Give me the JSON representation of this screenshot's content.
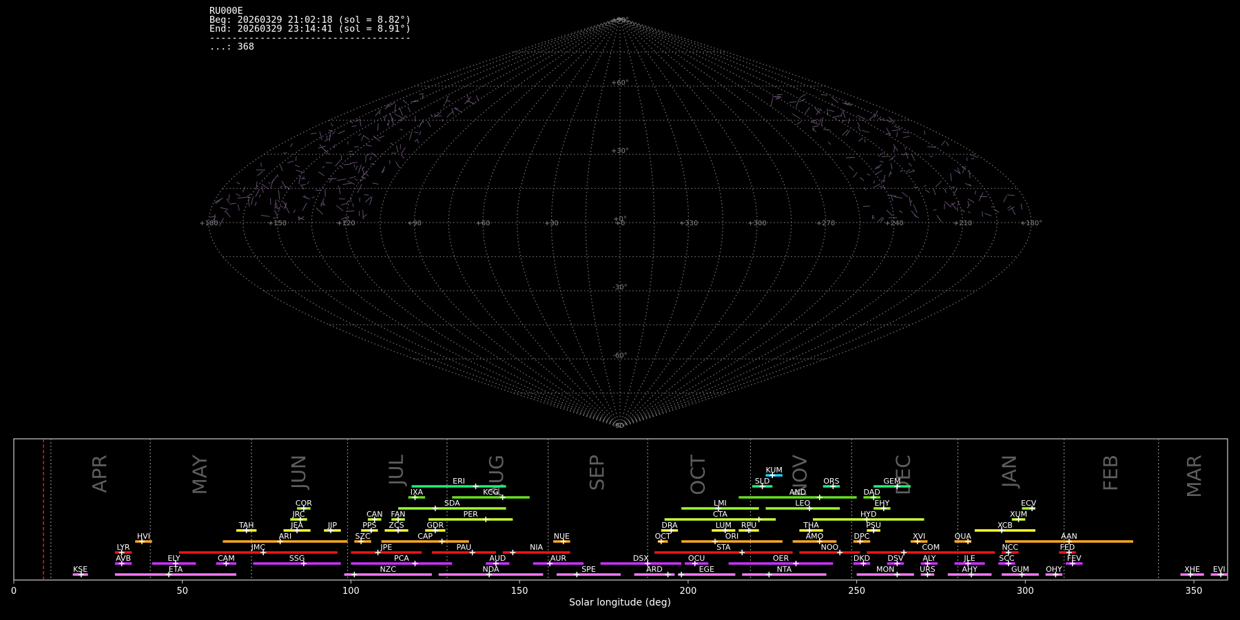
{
  "header": {
    "station": "RU000E",
    "begin": "Beg: 20260329 21:02:18 (sol = 8.82°)",
    "end": "End: 20260329 23:14:41 (sol = 8.91°)",
    "separator": "------------------------------------",
    "count": "...: 368"
  },
  "sky_map": {
    "projection": "sinusoidal",
    "lat_labels": [
      "+90°",
      "+60°",
      "+30°",
      "+0°",
      "-30°",
      "-60°",
      "-90°"
    ],
    "lat_values": [
      90,
      60,
      30,
      0,
      -30,
      -60,
      -90
    ],
    "lon_labels": [
      "+180",
      "+150",
      "+120",
      "+90",
      "+60",
      "+30",
      "+0",
      "+330",
      "+300",
      "+270",
      "+240",
      "+210",
      "+180°"
    ],
    "grid_color": "#888888",
    "meteor_color": "#8a6a9a"
  },
  "chart_data": {
    "type": "timeline",
    "xlabel": "Solar longitude (deg)",
    "xlim": [
      0,
      360
    ],
    "xticks": [
      0,
      50,
      100,
      150,
      200,
      250,
      300,
      350
    ],
    "current_sol": 8.82,
    "months": [
      {
        "label": "APR",
        "start": 11
      },
      {
        "label": "MAY",
        "start": 40.5
      },
      {
        "label": "JUN",
        "start": 70.5
      },
      {
        "label": "JUL",
        "start": 99
      },
      {
        "label": "AUG",
        "start": 128.5
      },
      {
        "label": "SEP",
        "start": 158.5
      },
      {
        "label": "OCT",
        "start": 188
      },
      {
        "label": "NOV",
        "start": 218.5
      },
      {
        "label": "DEC",
        "start": 248.5
      },
      {
        "label": "JAN",
        "start": 280
      },
      {
        "label": "FEB",
        "start": 311.5
      },
      {
        "label": "MAR",
        "start": 339.5
      }
    ],
    "rows_color": [
      "#ff77ff",
      "#cc33ff",
      "#ff1111",
      "#ffaa22",
      "#ffff33",
      "#ccff33",
      "#99ff33",
      "#66dd22",
      "#22ee77",
      "#22ccff",
      "#1111ff"
    ],
    "showers": [
      {
        "code": "KSE",
        "row": 0,
        "start": 17.5,
        "end": 22,
        "peak": 20
      },
      {
        "code": "ETA",
        "row": 0,
        "start": 30,
        "end": 66,
        "peak": 46
      },
      {
        "code": "NZC",
        "row": 0,
        "start": 98,
        "end": 124,
        "peak": 101
      },
      {
        "code": "NDA",
        "row": 0,
        "start": 126,
        "end": 157,
        "peak": 141
      },
      {
        "code": "SPE",
        "row": 0,
        "start": 161,
        "end": 180,
        "peak": 167
      },
      {
        "code": "ARD",
        "row": 0,
        "start": 184,
        "end": 196,
        "peak": 194
      },
      {
        "code": "EGE",
        "row": 0,
        "start": 197,
        "end": 214,
        "peak": 198
      },
      {
        "code": "NTA",
        "row": 0,
        "start": 216,
        "end": 241,
        "peak": 224
      },
      {
        "code": "MON",
        "row": 0,
        "start": 250,
        "end": 267,
        "peak": 262
      },
      {
        "code": "URS",
        "row": 0,
        "start": 269,
        "end": 273,
        "peak": 271
      },
      {
        "code": "AHY",
        "row": 0,
        "start": 277,
        "end": 290,
        "peak": 284
      },
      {
        "code": "GUM",
        "row": 0,
        "start": 293,
        "end": 304,
        "peak": 299
      },
      {
        "code": "OHY",
        "row": 0,
        "start": 306,
        "end": 311,
        "peak": 309
      },
      {
        "code": "XHE",
        "row": 0,
        "start": 346,
        "end": 353,
        "peak": 349
      },
      {
        "code": "EVI",
        "row": 0,
        "start": 355,
        "end": 360,
        "peak": 358
      },
      {
        "code": "AVB",
        "row": 1,
        "start": 30,
        "end": 35,
        "peak": 32
      },
      {
        "code": "ELY",
        "row": 1,
        "start": 41,
        "end": 54,
        "peak": 48
      },
      {
        "code": "CAM",
        "row": 1,
        "start": 60,
        "end": 66,
        "peak": 63
      },
      {
        "code": "SSG",
        "row": 1,
        "start": 71,
        "end": 97,
        "peak": 86
      },
      {
        "code": "PCA",
        "row": 1,
        "start": 100,
        "end": 130,
        "peak": 119
      },
      {
        "code": "AUD",
        "row": 1,
        "start": 140,
        "end": 147,
        "peak": 143
      },
      {
        "code": "AUR",
        "row": 1,
        "start": 154,
        "end": 169,
        "peak": 159
      },
      {
        "code": "DSX",
        "row": 1,
        "start": 174,
        "end": 198,
        "peak": 188
      },
      {
        "code": "OCU",
        "row": 1,
        "start": 199,
        "end": 206,
        "peak": 202
      },
      {
        "code": "OER",
        "row": 1,
        "start": 212,
        "end": 243,
        "peak": 232
      },
      {
        "code": "DKD",
        "row": 1,
        "start": 249,
        "end": 254,
        "peak": 252
      },
      {
        "code": "DSV",
        "row": 1,
        "start": 259,
        "end": 264,
        "peak": 262
      },
      {
        "code": "ALY",
        "row": 1,
        "start": 269,
        "end": 274,
        "peak": 271
      },
      {
        "code": "JLE",
        "row": 1,
        "start": 279,
        "end": 288,
        "peak": 283
      },
      {
        "code": "SCC",
        "row": 1,
        "start": 292,
        "end": 297,
        "peak": 295
      },
      {
        "code": "FEV",
        "row": 1,
        "start": 312,
        "end": 317,
        "peak": 314
      },
      {
        "code": "LYR",
        "row": 2,
        "start": 30,
        "end": 35,
        "peak": 32
      },
      {
        "code": "JMC",
        "row": 2,
        "start": 49,
        "end": 96,
        "peak": 74
      },
      {
        "code": "JPE",
        "row": 2,
        "start": 100,
        "end": 121,
        "peak": 108
      },
      {
        "code": "PAU",
        "row": 2,
        "start": 124,
        "end": 143,
        "peak": 136
      },
      {
        "code": "NIA",
        "row": 2,
        "start": 145,
        "end": 165,
        "peak": 148
      },
      {
        "code": "STA",
        "row": 2,
        "start": 190,
        "end": 231,
        "peak": 216
      },
      {
        "code": "NOO",
        "row": 2,
        "start": 233,
        "end": 251,
        "peak": 245
      },
      {
        "code": "COM",
        "row": 2,
        "start": 253,
        "end": 291,
        "peak": 264
      },
      {
        "code": "NCC",
        "row": 2,
        "start": 293,
        "end": 298,
        "peak": 295
      },
      {
        "code": "FED",
        "row": 2,
        "start": 310,
        "end": 315,
        "peak": 313
      },
      {
        "code": "HVI",
        "row": 3,
        "start": 36,
        "end": 41,
        "peak": 38
      },
      {
        "code": "ARI",
        "row": 3,
        "start": 62,
        "end": 99,
        "peak": 79
      },
      {
        "code": "SZC",
        "row": 3,
        "start": 101,
        "end": 106,
        "peak": 103
      },
      {
        "code": "CAP",
        "row": 3,
        "start": 109,
        "end": 135,
        "peak": 127
      },
      {
        "code": "NUE",
        "row": 3,
        "start": 160,
        "end": 165,
        "peak": 163
      },
      {
        "code": "OCT",
        "row": 3,
        "start": 191,
        "end": 194,
        "peak": 192
      },
      {
        "code": "ORI",
        "row": 3,
        "start": 198,
        "end": 228,
        "peak": 208
      },
      {
        "code": "AMO",
        "row": 3,
        "start": 231,
        "end": 244,
        "peak": 239
      },
      {
        "code": "DPC",
        "row": 3,
        "start": 249,
        "end": 254,
        "peak": 251
      },
      {
        "code": "XVI",
        "row": 3,
        "start": 266,
        "end": 271,
        "peak": 268
      },
      {
        "code": "QUA",
        "row": 3,
        "start": 279,
        "end": 284,
        "peak": 283
      },
      {
        "code": "AAN",
        "row": 3,
        "start": 294,
        "end": 332,
        "peak": 313
      },
      {
        "code": "TAH",
        "row": 4,
        "start": 66,
        "end": 72,
        "peak": 69
      },
      {
        "code": "JEA",
        "row": 4,
        "start": 80,
        "end": 88,
        "peak": 84
      },
      {
        "code": "JIP",
        "row": 4,
        "start": 92,
        "end": 97,
        "peak": 94
      },
      {
        "code": "PPS",
        "row": 4,
        "start": 103,
        "end": 108,
        "peak": 106
      },
      {
        "code": "ZCS",
        "row": 4,
        "start": 110,
        "end": 117,
        "peak": 114
      },
      {
        "code": "GDR",
        "row": 4,
        "start": 122,
        "end": 128,
        "peak": 125
      },
      {
        "code": "DRA",
        "row": 4,
        "start": 192,
        "end": 197,
        "peak": 195
      },
      {
        "code": "LUM",
        "row": 4,
        "start": 207,
        "end": 214,
        "peak": 211
      },
      {
        "code": "RPU",
        "row": 4,
        "start": 215,
        "end": 221,
        "peak": 218
      },
      {
        "code": "THA",
        "row": 4,
        "start": 233,
        "end": 240,
        "peak": 236
      },
      {
        "code": "PSU",
        "row": 4,
        "start": 253,
        "end": 257,
        "peak": 255
      },
      {
        "code": "XCB",
        "row": 4,
        "start": 285,
        "end": 303,
        "peak": 293
      },
      {
        "code": "JRC",
        "row": 5,
        "start": 82,
        "end": 87,
        "peak": 85
      },
      {
        "code": "CAN",
        "row": 5,
        "start": 105,
        "end": 109,
        "peak": 107
      },
      {
        "code": "FAN",
        "row": 5,
        "start": 112,
        "end": 116,
        "peak": 114
      },
      {
        "code": "PER",
        "row": 5,
        "start": 123,
        "end": 148,
        "peak": 140
      },
      {
        "code": "CTA",
        "row": 5,
        "start": 193,
        "end": 226,
        "peak": 221
      },
      {
        "code": "HYD",
        "row": 5,
        "start": 237,
        "end": 270,
        "peak": 253
      },
      {
        "code": "XUM",
        "row": 5,
        "start": 296,
        "end": 300,
        "peak": 298
      },
      {
        "code": "COR",
        "row": 6,
        "start": 84,
        "end": 88,
        "peak": 86
      },
      {
        "code": "SDA",
        "row": 6,
        "start": 114,
        "end": 146,
        "peak": 125
      },
      {
        "code": "LMI",
        "row": 6,
        "start": 198,
        "end": 221,
        "peak": 209
      },
      {
        "code": "LEO",
        "row": 6,
        "start": 223,
        "end": 245,
        "peak": 236
      },
      {
        "code": "EHY",
        "row": 6,
        "start": 255,
        "end": 260,
        "peak": 258
      },
      {
        "code": "ECV",
        "row": 6,
        "start": 299,
        "end": 303,
        "peak": 302
      },
      {
        "code": "IXA",
        "row": 7,
        "start": 117,
        "end": 122,
        "peak": 119
      },
      {
        "code": "KCG",
        "row": 7,
        "start": 130,
        "end": 153,
        "peak": 145
      },
      {
        "code": "AND",
        "row": 7,
        "start": 215,
        "end": 250,
        "peak": 239
      },
      {
        "code": "DAD",
        "row": 7,
        "start": 252,
        "end": 257,
        "peak": 255
      },
      {
        "code": "ERI",
        "row": 8,
        "start": 118,
        "end": 146,
        "peak": 137
      },
      {
        "code": "SLD",
        "row": 8,
        "start": 219,
        "end": 225,
        "peak": 222
      },
      {
        "code": "ORS",
        "row": 8,
        "start": 240,
        "end": 245,
        "peak": 243
      },
      {
        "code": "GEM",
        "row": 8,
        "start": 255,
        "end": 266,
        "peak": 262
      },
      {
        "code": "KUM",
        "row": 9,
        "start": 223,
        "end": 228,
        "peak": 225
      }
    ]
  }
}
